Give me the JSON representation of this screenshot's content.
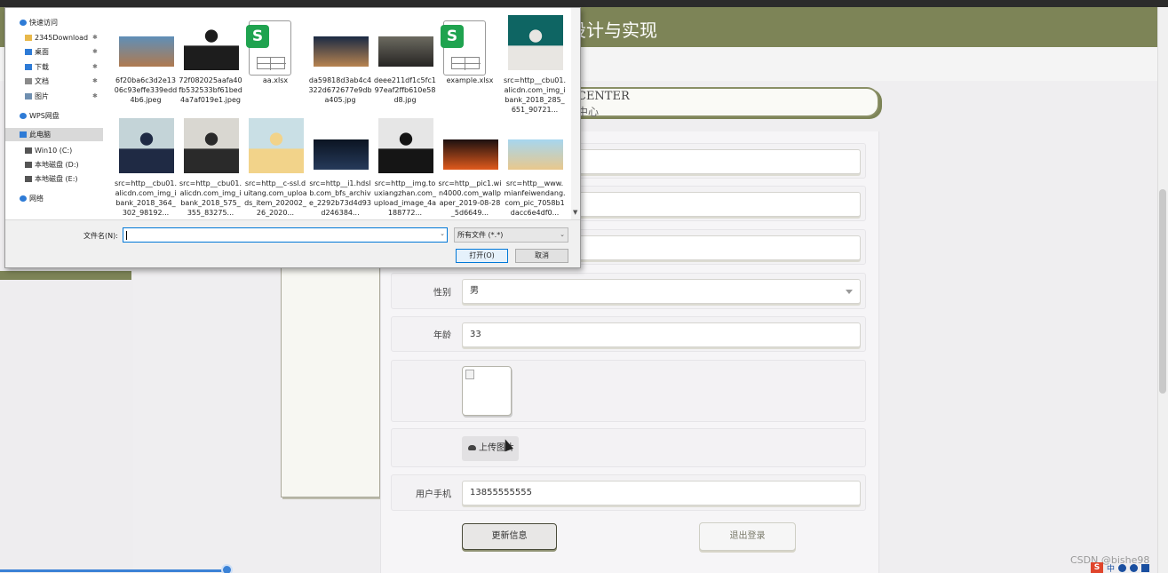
{
  "app": {
    "header_title": "设计与实现",
    "center_en": "CENTER",
    "center_cn": "中心",
    "accent_color": "#7d8457"
  },
  "form": {
    "gender_label": "性别",
    "gender_value": "男",
    "age_label": "年龄",
    "age_value": "33",
    "upload_label": "上传图片",
    "phone_label": "用户手机",
    "phone_value": "13855555555",
    "update_button": "更新信息",
    "logout_button": "退出登录"
  },
  "dialog": {
    "nav": [
      {
        "label": "快速访问",
        "icon": "star-icon",
        "pinned": false
      },
      {
        "label": "2345Download",
        "icon": "folder-icon",
        "pinned": true
      },
      {
        "label": "桌面",
        "icon": "desktop-icon",
        "pinned": true
      },
      {
        "label": "下载",
        "icon": "download-icon",
        "pinned": true
      },
      {
        "label": "文档",
        "icon": "document-icon",
        "pinned": true
      },
      {
        "label": "图片",
        "icon": "picture-icon",
        "pinned": true
      },
      {
        "label": "WPS网盘",
        "icon": "cloud-icon",
        "pinned": false
      },
      {
        "label": "此电脑",
        "icon": "computer-icon",
        "pinned": false
      },
      {
        "label": "Win10 (C:)",
        "icon": "drive-icon",
        "pinned": false
      },
      {
        "label": "本地磁盘 (D:)",
        "icon": "drive-icon",
        "pinned": false
      },
      {
        "label": "本地磁盘 (E:)",
        "icon": "drive-icon",
        "pinned": false
      },
      {
        "label": "网络",
        "icon": "network-icon",
        "pinned": false
      }
    ],
    "pin_glyph": "✱",
    "files": [
      {
        "name": "6f20ba6c3d2e1306c93effe339edd4b6.jpeg",
        "kind": "image",
        "colors": [
          "#5f8fb8",
          "#b07a4f"
        ]
      },
      {
        "name": "72f082025aafa40fb532533bf61bed4a7af019e1.jpeg",
        "kind": "portrait",
        "colors": [
          "#ffffff",
          "#1d1d1d"
        ]
      },
      {
        "name": "aa.xlsx",
        "kind": "xlsx",
        "colors": []
      },
      {
        "name": "da59818d3ab4c4322d672677e9dba405.jpg",
        "kind": "image",
        "colors": [
          "#1a2a44",
          "#b88450"
        ]
      },
      {
        "name": "deee211df1c5fc197eaf2ffb610e58d8.jpg",
        "kind": "image",
        "colors": [
          "#6c6a60",
          "#262523"
        ]
      },
      {
        "name": "example.xlsx",
        "kind": "xlsx",
        "colors": []
      },
      {
        "name": "src=http__cbu01.alicdn.com_img_ibank_2018_285_651_90721...",
        "kind": "portrait",
        "colors": [
          "#0e6563",
          "#e8e6e2"
        ]
      },
      {
        "name": "src=http__cbu01.alicdn.com_img_ibank_2018_364_302_98192...",
        "kind": "portrait",
        "colors": [
          "#c4d4d8",
          "#1f2a44"
        ]
      },
      {
        "name": "src=http__cbu01.alicdn.com_img_ibank_2018_575_355_83275...",
        "kind": "portrait",
        "colors": [
          "#d9d7d1",
          "#2a2a2a"
        ]
      },
      {
        "name": "src=http__c-ssl.duitang.com_uploads_item_202002_26_2020...",
        "kind": "portrait",
        "colors": [
          "#c9dfe5",
          "#f2d38a"
        ]
      },
      {
        "name": "src=http__i1.hdslb.com_bfs_archive_2292b73d4d93d246384...",
        "kind": "image",
        "colors": [
          "#0b1422",
          "#263a5a"
        ]
      },
      {
        "name": "src=http__img.touxiangzhan.com_upload_image_4a188772...",
        "kind": "portrait",
        "colors": [
          "#e6e6e6",
          "#151515"
        ]
      },
      {
        "name": "src=http__pic1.win4000.com_wallpaper_2019-08-28_5d6649...",
        "kind": "image",
        "colors": [
          "#1b1010",
          "#e05a1c"
        ]
      },
      {
        "name": "src=http__www.mianfeiwendang.com_pic_7058b1dacc6e4df0...",
        "kind": "image",
        "colors": [
          "#a6d6ef",
          "#e9c88c"
        ]
      }
    ],
    "filename_label": "文件名(N):",
    "filename_value": "",
    "filetype_value": "所有文件 (*.*)",
    "open_button": "打开(O)",
    "cancel_button": "取消"
  },
  "taskbar": {
    "watermark": "CSDN @bishe98",
    "tray_s": "S",
    "tray_zh": "中"
  }
}
